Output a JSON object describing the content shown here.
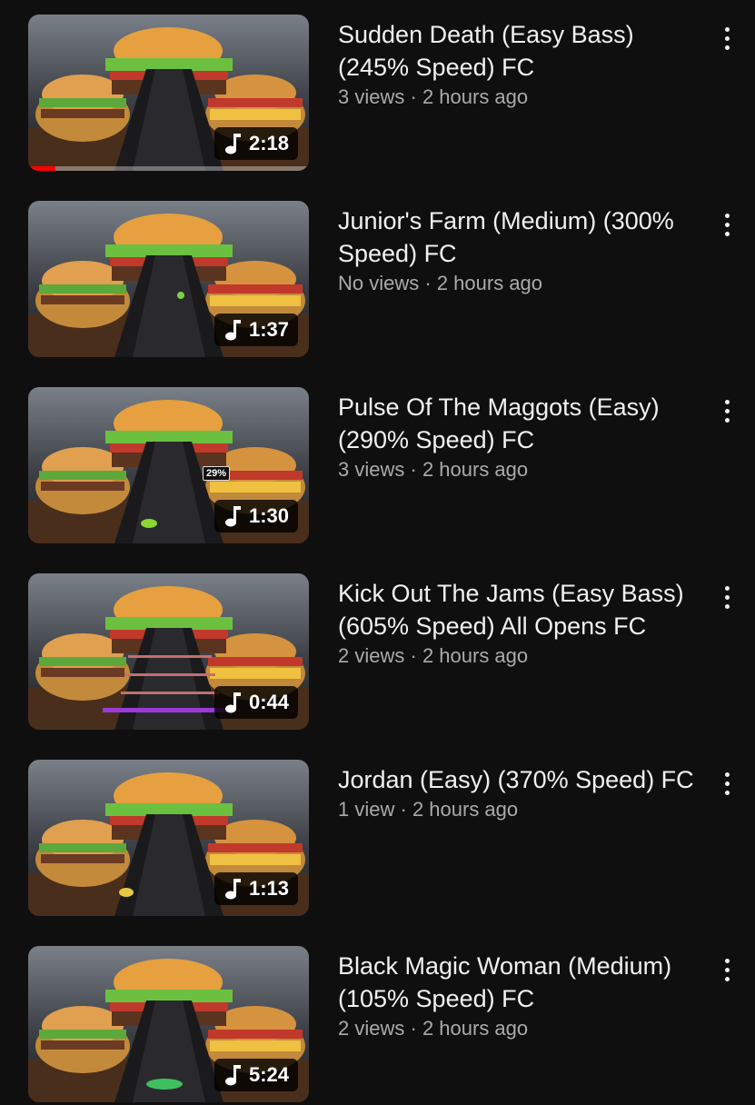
{
  "videos": [
    {
      "title": "Sudden Death (Easy Bass) (245% Speed) FC",
      "views": "3 views",
      "age": "2 hours ago",
      "duration": "2:18",
      "watched_fraction": 0.1
    },
    {
      "title": "Junior's Farm (Medium) (300% Speed) FC",
      "views": "No views",
      "age": "2 hours ago",
      "duration": "1:37"
    },
    {
      "title": "Pulse Of The Maggots (Easy) (290% Speed) FC",
      "views": "3 views",
      "age": "2 hours ago",
      "duration": "1:30",
      "overlay": "29%"
    },
    {
      "title": "Kick Out The Jams (Easy Bass) (605% Speed) All Opens FC",
      "views": "2 views",
      "age": "2 hours ago",
      "duration": "0:44"
    },
    {
      "title": "Jordan (Easy) (370% Speed) FC",
      "views": "1 view",
      "age": "2 hours ago",
      "duration": "1:13"
    },
    {
      "title": "Black Magic Woman (Medium) (105% Speed) FC",
      "views": "2 views",
      "age": "2 hours ago",
      "duration": "5:24"
    }
  ],
  "separator": "·",
  "icons": {
    "menu": "more-vert-icon",
    "duration": "music-note-icon"
  }
}
